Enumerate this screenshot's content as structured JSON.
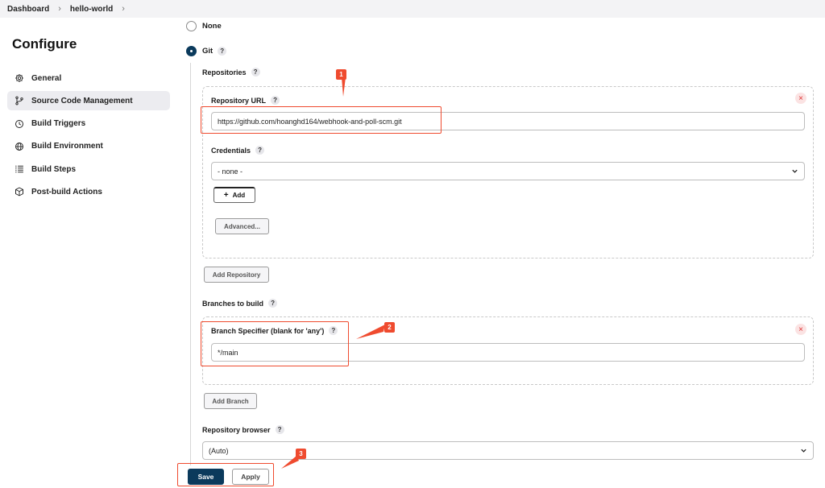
{
  "breadcrumb": {
    "items": [
      "Dashboard",
      "hello-world"
    ]
  },
  "sidebar": {
    "title": "Configure",
    "items": [
      {
        "label": "General",
        "icon": "gear-icon"
      },
      {
        "label": "Source Code Management",
        "icon": "branch-icon"
      },
      {
        "label": "Build Triggers",
        "icon": "clock-icon"
      },
      {
        "label": "Build Environment",
        "icon": "globe-icon"
      },
      {
        "label": "Build Steps",
        "icon": "list-icon"
      },
      {
        "label": "Post-build Actions",
        "icon": "package-icon"
      }
    ],
    "active_index": 1
  },
  "scm": {
    "options": {
      "none": "None",
      "git": "Git"
    },
    "selected": "Git"
  },
  "repositories": {
    "label": "Repositories",
    "url_label": "Repository URL",
    "url_value": "https://github.com/hoanghd164/webhook-and-poll-scm.git",
    "credentials_label": "Credentials",
    "credentials_value": "- none -",
    "add_label": "Add",
    "advanced_label": "Advanced...",
    "add_repository_label": "Add Repository"
  },
  "branches": {
    "label": "Branches to build",
    "specifier_label": "Branch Specifier (blank for 'any')",
    "specifier_value": "*/main",
    "add_branch_label": "Add Branch"
  },
  "browser": {
    "label": "Repository browser",
    "value": "(Auto)"
  },
  "actions": {
    "save_label": "Save",
    "apply_label": "Apply"
  },
  "annotations": {
    "badges": [
      "1",
      "2",
      "3"
    ]
  },
  "help_glyph": "?",
  "close_glyph": "×",
  "colors": {
    "accent": "#0b3a5c",
    "annotation": "#ef4b2f"
  }
}
